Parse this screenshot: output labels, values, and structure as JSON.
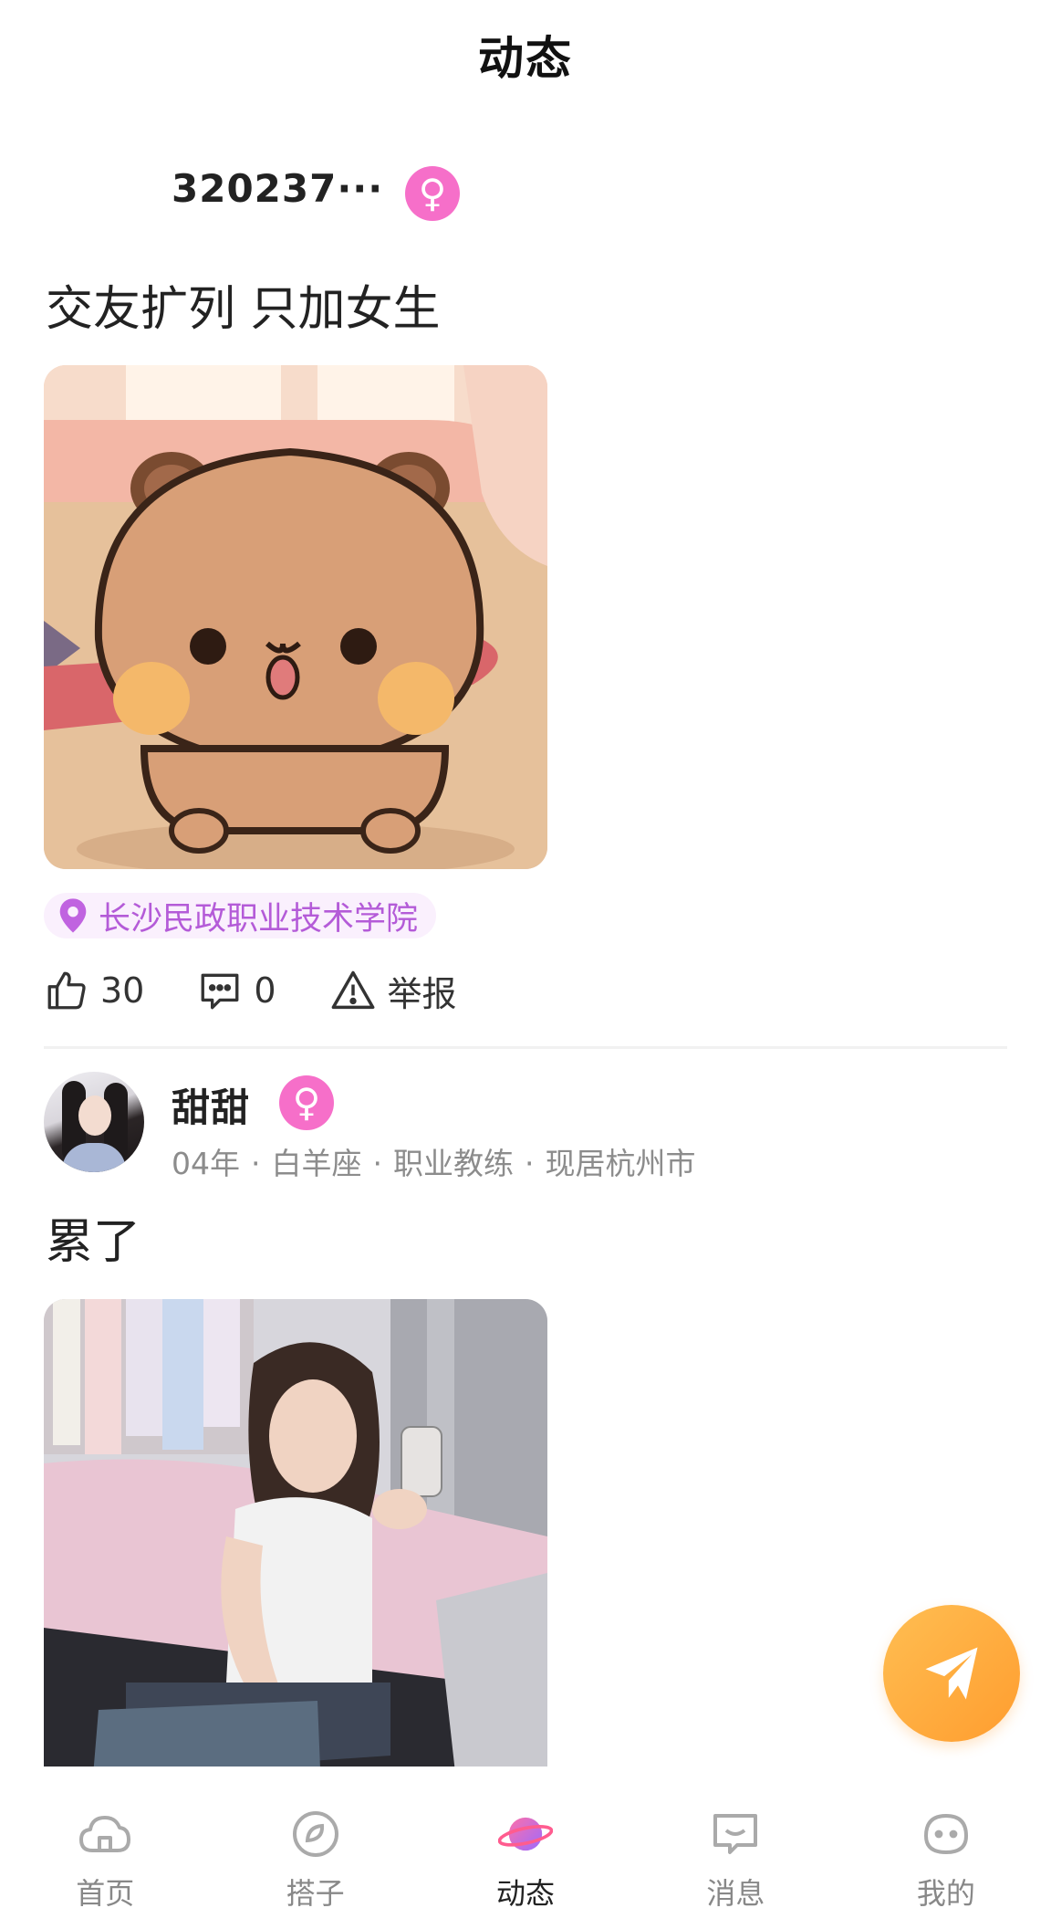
{
  "header": {
    "title": "动态"
  },
  "posts": [
    {
      "username": "320237···",
      "gender_symbol": "♀",
      "text": "交友扩列 只加女生",
      "location": "长沙民政职业技术学院",
      "likes": "30",
      "comments": "0",
      "report_label": "举报"
    },
    {
      "username": "甜甜",
      "gender_symbol": "♀",
      "meta": {
        "year": "04年",
        "zodiac": "白羊座",
        "job": "职业教练",
        "city": "现居杭州市",
        "separator": "·"
      },
      "text": "累了"
    }
  ],
  "tabbar": {
    "items": [
      {
        "label": "首页",
        "icon": "home-cloud-icon"
      },
      {
        "label": "搭子",
        "icon": "partner-ring-icon"
      },
      {
        "label": "动态",
        "icon": "planet-icon",
        "active": true
      },
      {
        "label": "消息",
        "icon": "message-icon"
      },
      {
        "label": "我的",
        "icon": "face-icon"
      }
    ]
  },
  "colors": {
    "female_badge": "#f66fc9",
    "location_text": "#b45bd8",
    "fab": "#ffa83a"
  }
}
